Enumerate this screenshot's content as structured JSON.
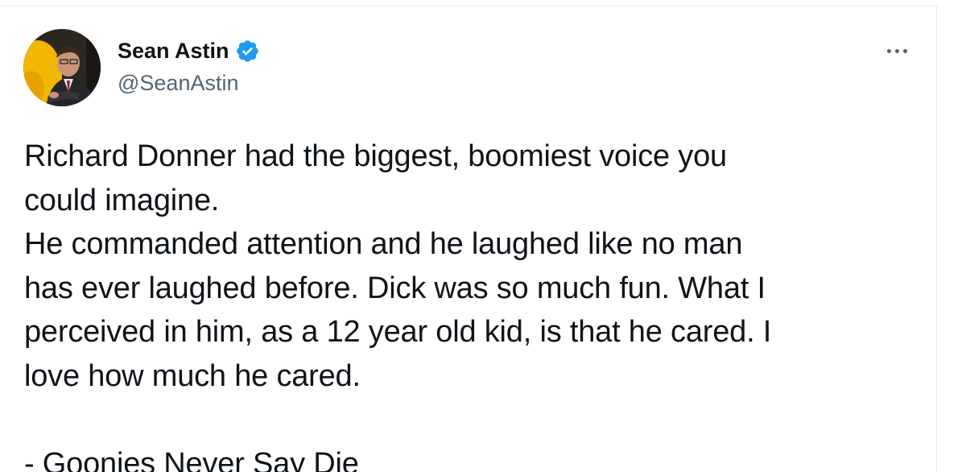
{
  "author": {
    "display_name": "Sean Astin",
    "handle": "@SeanAstin",
    "verified": true,
    "verified_color": "#1d9bf0",
    "avatar_icon": "avatar-photo-man-in-suit-yellow-background"
  },
  "menu": {
    "icon": "more-options-icon"
  },
  "tweet": {
    "paragraphs": [
      "Richard Donner had the biggest, boomiest voice you\ncould imagine.",
      "He commanded attention and he laughed like no man\nhas ever laughed before. Dick was so much fun. What I\nperceived in him, as a 12 year old kid, is that he cared. I\nlove how much he cared.",
      "- Goonies Never Say Die"
    ]
  }
}
